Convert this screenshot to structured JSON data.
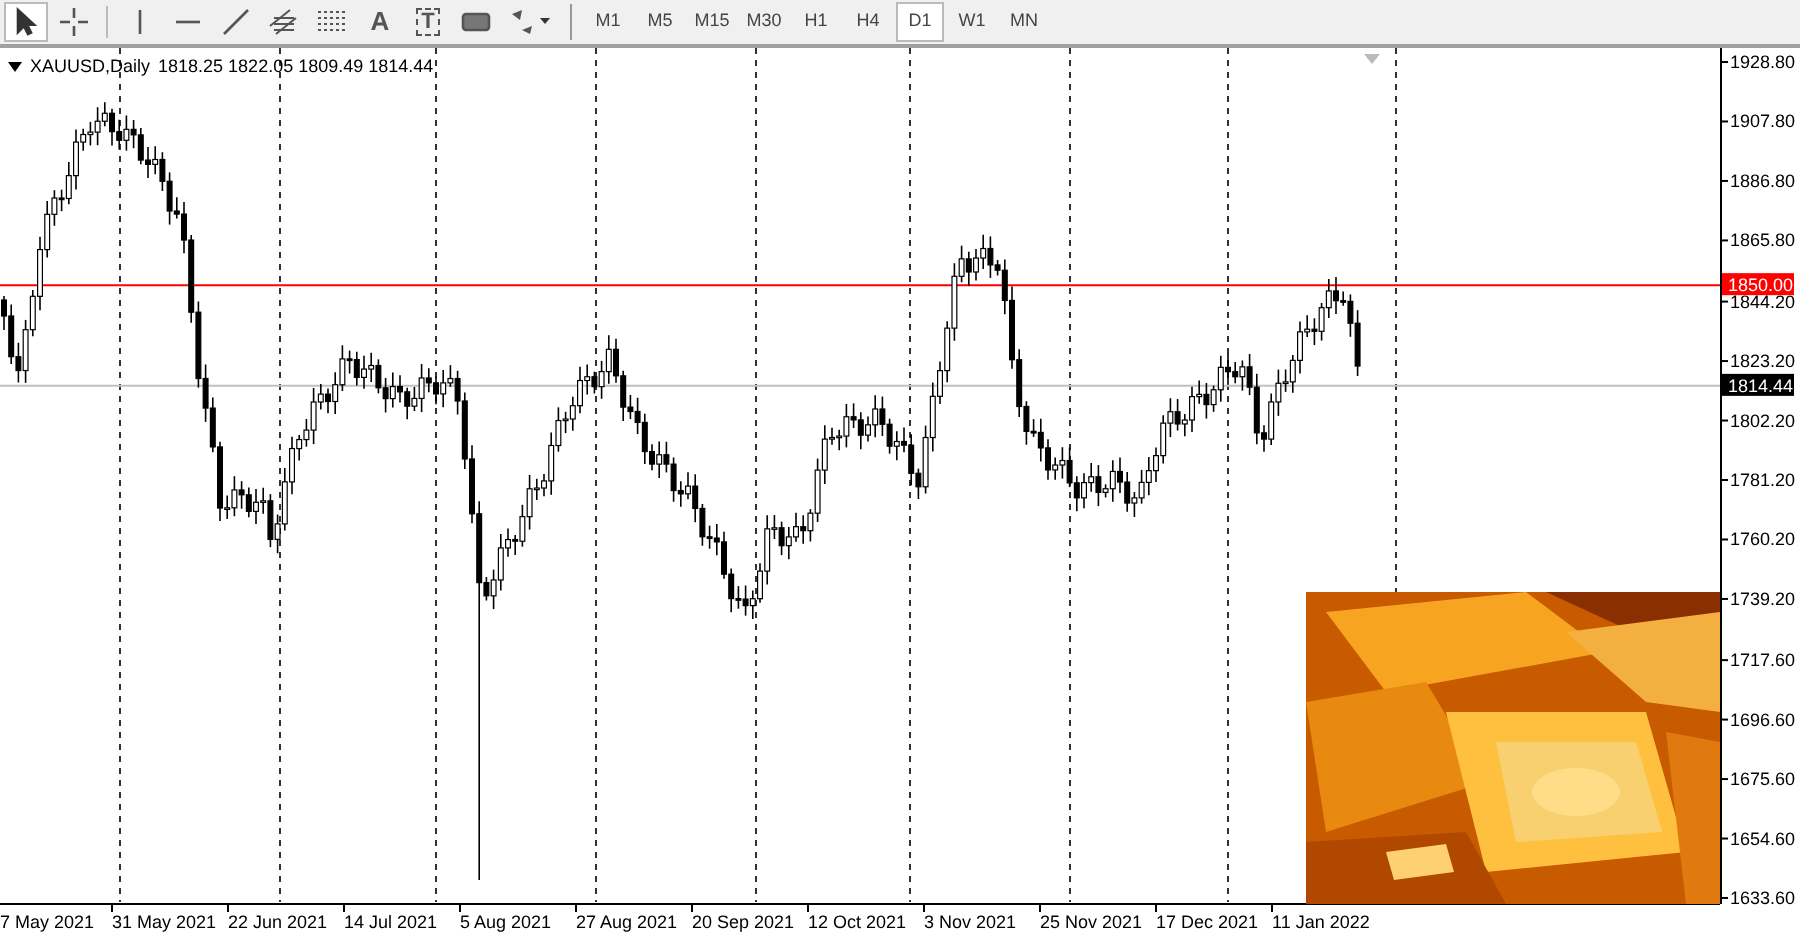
{
  "toolbar": {
    "tools": [
      {
        "kind": "cursor",
        "selected": true
      },
      {
        "kind": "crosshair",
        "selected": false
      },
      {
        "kind": "vline",
        "selected": false
      },
      {
        "kind": "hline",
        "selected": false
      },
      {
        "kind": "trendline",
        "selected": false
      },
      {
        "kind": "channel",
        "selected": false
      },
      {
        "kind": "fibo",
        "selected": false
      },
      {
        "kind": "text",
        "glyph": "A",
        "selected": false
      },
      {
        "kind": "label",
        "glyph": "T",
        "selected": false
      },
      {
        "kind": "shape",
        "selected": false
      },
      {
        "kind": "arrows",
        "selected": false
      }
    ],
    "timeframes": [
      {
        "label": "M1",
        "selected": false
      },
      {
        "label": "M5",
        "selected": false
      },
      {
        "label": "M15",
        "selected": false
      },
      {
        "label": "M30",
        "selected": false
      },
      {
        "label": "H1",
        "selected": false
      },
      {
        "label": "H4",
        "selected": false
      },
      {
        "label": "D1",
        "selected": true
      },
      {
        "label": "W1",
        "selected": false
      },
      {
        "label": "MN",
        "selected": false
      }
    ]
  },
  "chart": {
    "symbol": "XAUUSD,Daily",
    "ohlc": "1818.25 1822.05 1809.49 1814.44",
    "price_axis": [
      "1928.80",
      "1907.80",
      "1886.80",
      "1865.80",
      "1844.20",
      "1823.20",
      "1802.20",
      "1781.20",
      "1760.20",
      "1739.20",
      "1717.60",
      "1696.60",
      "1675.60",
      "1654.60",
      "1633.60"
    ],
    "level_line": {
      "label": "1850.00",
      "color": "#ff0000"
    },
    "bid_line": {
      "label": "1814.44"
    },
    "date_axis": [
      "7 May 2021",
      "31 May 2021",
      "22 Jun 2021",
      "14 Jul 2021",
      "5 Aug 2021",
      "27 Aug 2021",
      "20 Sep 2021",
      "12 Oct 2021",
      "3 Nov 2021",
      "25 Nov 2021",
      "17 Dec 2021",
      "11 Jan 2022"
    ]
  }
}
